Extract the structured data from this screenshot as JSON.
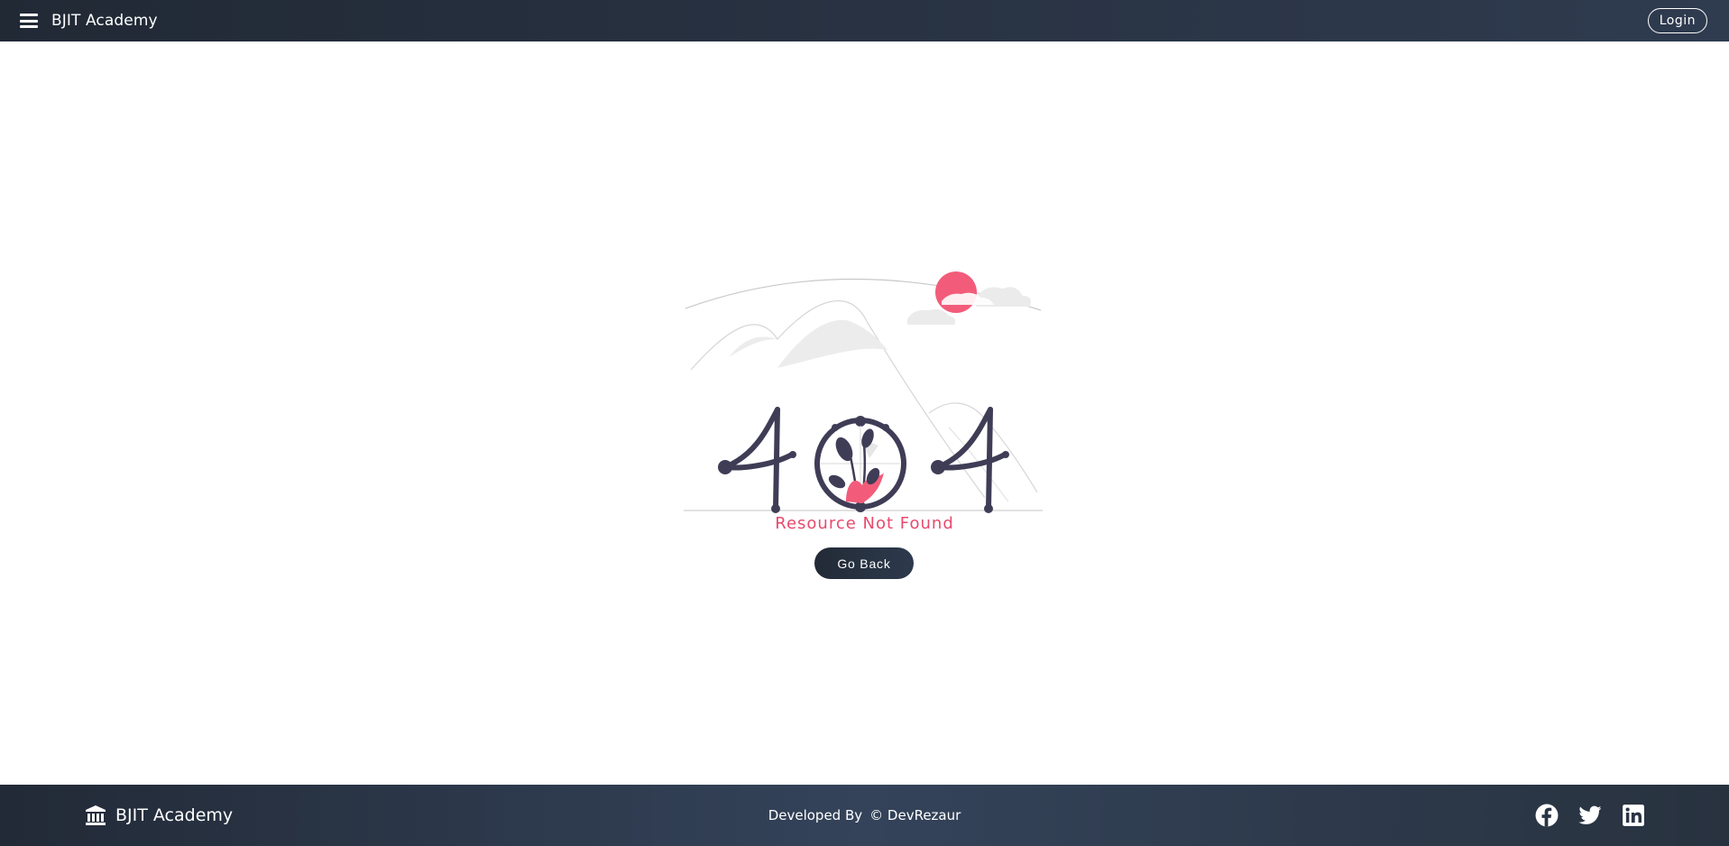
{
  "header": {
    "menu_icon": "hamburger-menu-icon",
    "title": "BJIT Academy",
    "login_label": "Login"
  },
  "main": {
    "illustration": {
      "icon": "404-illustration",
      "digits": "404"
    },
    "error_message": "Resource Not Found",
    "go_back_label": "Go Back"
  },
  "footer": {
    "brand_icon": "institution-icon",
    "brand_title": "BJIT Academy",
    "credit_prefix": "Developed By",
    "credit_author": "© DevRezaur",
    "social": [
      {
        "icon": "facebook-icon"
      },
      {
        "icon": "twitter-icon"
      },
      {
        "icon": "linkedin-icon"
      }
    ]
  },
  "colors": {
    "header_bg": "#212935",
    "accent": "#e8496c",
    "illustration_dark": "#3f3d56",
    "footer_bg": "#2f3b4f"
  }
}
